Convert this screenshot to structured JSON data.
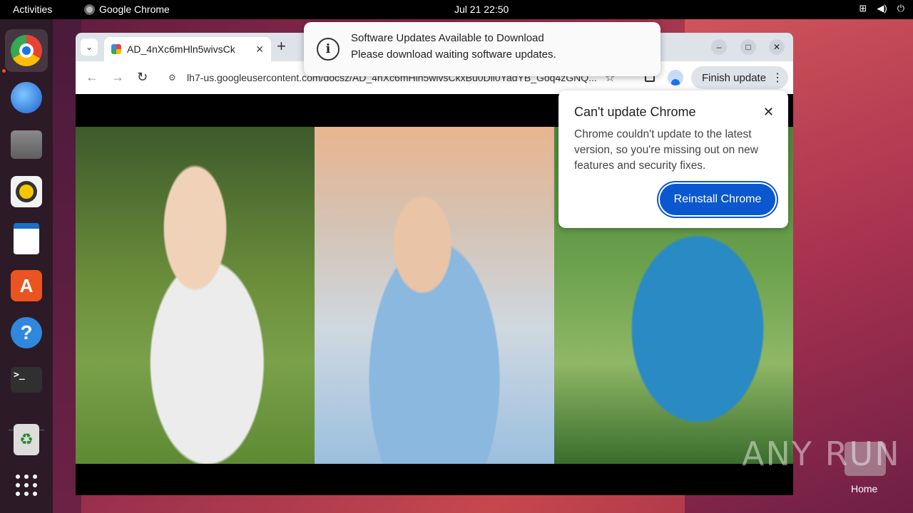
{
  "topbar": {
    "activities": "Activities",
    "app_name": "Google Chrome",
    "clock": "Jul 21  22:50",
    "tray_icons": [
      "network-icon",
      "volume-icon",
      "power-icon"
    ]
  },
  "dock": {
    "items": [
      "chrome-icon",
      "thunderbird-icon",
      "files-icon",
      "rhythmbox-icon",
      "writer-icon",
      "app-store-icon",
      "help-icon",
      "terminal-icon",
      "trash-icon",
      "app-grid-icon"
    ],
    "terminal_glyph": ">_",
    "help_glyph": "?",
    "store_glyph": "A",
    "trash_glyph": "♻"
  },
  "browser": {
    "tab_title": "AD_4nXc6mHln5wivsCk",
    "new_tab_glyph": "+",
    "url": "lh7-us.googleusercontent.com/docsz/AD_4nXc6mHln5wivsCkxBu0Dll0YadYB_Goq4zGNQ...",
    "finish_update_label": "Finish update",
    "accent": "#0b57d0"
  },
  "update_popup": {
    "title": "Can't update Chrome",
    "body": "Chrome couldn't update to the latest version, so you're missing out on new features and security fixes.",
    "button": "Reinstall Chrome"
  },
  "notification": {
    "title": "Software Updates Available to Download",
    "body": "Please download waiting software updates."
  },
  "desktop": {
    "home_label": "Home",
    "watermark": "ANY RUN"
  }
}
